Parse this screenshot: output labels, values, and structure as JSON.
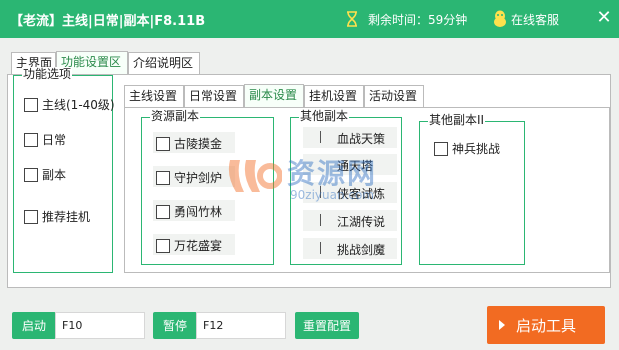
{
  "window": {
    "title": "【老流】主线|日常|副本|F8.11B",
    "timer_text": "剩余时间：59分钟",
    "support_text": "在线客服",
    "close_glyph": "✕"
  },
  "outer_tabs": [
    {
      "label": "主界面"
    },
    {
      "label": "功能设置区",
      "active": true
    },
    {
      "label": "介绍说明区"
    }
  ],
  "function_options": {
    "legend": "功能选项",
    "items": [
      {
        "label": "主线(1-40级)"
      },
      {
        "label": "日常"
      },
      {
        "label": "副本"
      },
      {
        "label": "推荐挂机"
      }
    ]
  },
  "inner_tabs": [
    {
      "label": "主线设置"
    },
    {
      "label": "日常设置"
    },
    {
      "label": "副本设置",
      "active": true
    },
    {
      "label": "挂机设置"
    },
    {
      "label": "活动设置"
    }
  ],
  "resource_dungeons": {
    "legend": "资源副本",
    "items": [
      {
        "label": "古陵摸金"
      },
      {
        "label": "守护剑炉"
      },
      {
        "label": "勇闯竹林"
      },
      {
        "label": "万花盛宴"
      }
    ]
  },
  "other_dungeons": {
    "legend": "其他副本",
    "items": [
      {
        "label": "血战天策"
      },
      {
        "label": "通天塔"
      },
      {
        "label": "侠客试炼"
      },
      {
        "label": "江湖传说"
      },
      {
        "label": "挑战剑魔"
      }
    ]
  },
  "other_dungeons_2": {
    "legend": "其他副本II",
    "items": [
      {
        "label": "神兵挑战"
      }
    ]
  },
  "bottom": {
    "start_label": "启动",
    "start_key": "F10",
    "pause_label": "暂停",
    "pause_key": "F12",
    "reset_label": "重置配置",
    "launch_label": "启动工具"
  },
  "watermark": {
    "main": "资源网",
    "sub": "90ziyuan.com"
  },
  "colors": {
    "accent": "#2bb673",
    "launch": "#f26b22"
  }
}
